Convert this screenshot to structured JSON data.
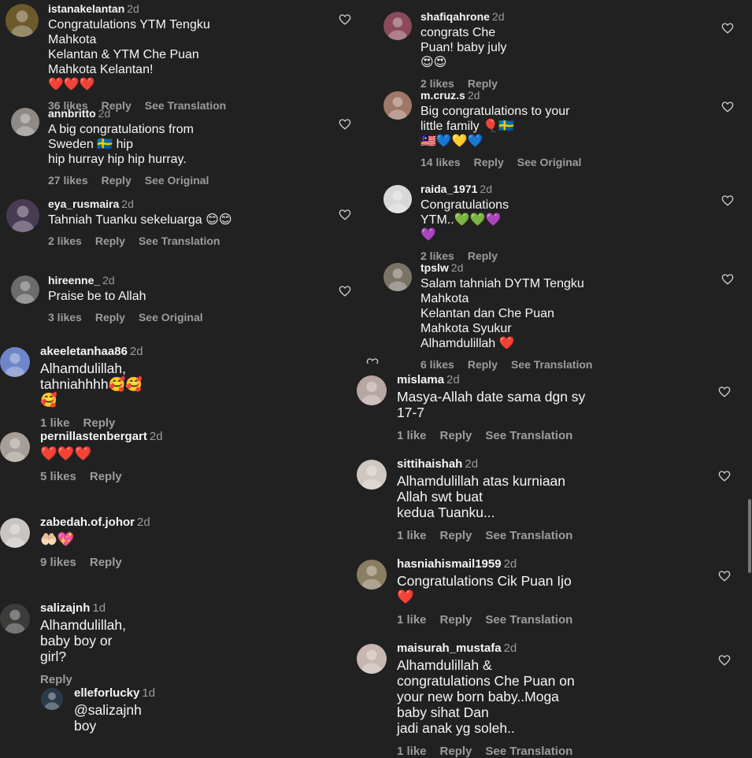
{
  "comments": [
    {
      "user": "istanakelantan",
      "time": "2d",
      "text": "Congratulations YTM Tengku Mahkota\nKelantan & YTM Che Puan Mahkota Kelantan!\n❤️❤️❤️",
      "likes": "36 likes",
      "reply": "Reply",
      "extra": "See Translation",
      "avatar_color": "#6b5a2a"
    },
    {
      "user": "annbritto",
      "time": "2d",
      "text": "A big congratulations from Sweden 🇸🇪 hip\nhip hurray hip hip hurray.",
      "likes": "27 likes",
      "reply": "Reply",
      "extra": "See Original",
      "avatar_color": "#8f8a86"
    },
    {
      "user": "eya_rusmaira",
      "time": "2d",
      "text": "Tahniah Tuanku sekeluarga 😊😊",
      "likes": "2 likes",
      "reply": "Reply",
      "extra": "See Translation",
      "avatar_color": "#4a3b55"
    },
    {
      "user": "hireenne_",
      "time": "2d",
      "text": "Praise be to Allah",
      "likes": "3 likes",
      "reply": "Reply",
      "extra": "See Original",
      "avatar_color": "#6c6c6c"
    },
    {
      "user": "akeeletanhaa86",
      "time": "2d",
      "text": "Alhamdulillah, tahniahhhh🥰🥰🥰",
      "likes": "1 like",
      "reply": "Reply",
      "extra": "",
      "avatar_color": "#6f86c9"
    },
    {
      "user": "pernillastenbergart",
      "time": "2d",
      "text": "❤️❤️❤️",
      "likes": "5 likes",
      "reply": "Reply",
      "extra": "",
      "avatar_color": "#a79e97"
    },
    {
      "user": "zabedah.of.johor",
      "time": "2d",
      "text": "🤲🏻💖",
      "likes": "9 likes",
      "reply": "Reply",
      "extra": "",
      "avatar_color": "#c9c4c2"
    },
    {
      "user": "salizajnh",
      "time": "1d",
      "text": "Alhamdulillah, baby boy or girl?",
      "likes": "",
      "reply": "Reply",
      "extra": "",
      "avatar_color": "#3c3c3a"
    },
    {
      "user": "elleforlucky",
      "time": "1d",
      "text": "@salizajnh boy",
      "likes": "",
      "reply": "",
      "extra": "",
      "avatar_color": "#2b3a4a"
    },
    {
      "user": "shafiqahrone",
      "time": "2d",
      "text": "congrats Che Puan! baby july 😍😍",
      "likes": "2 likes",
      "reply": "Reply",
      "extra": "",
      "avatar_color": "#8a4a5a"
    },
    {
      "user": "m.cruz.s",
      "time": "2d",
      "text": "Big congratulations to your little family 🎈🇸🇪\n🇲🇾💙💛💙",
      "likes": "14 likes",
      "reply": "Reply",
      "extra": "See Original",
      "avatar_color": "#a07868"
    },
    {
      "user": "raida_1971",
      "time": "2d",
      "text": "Congratulations YTM..💚💚💜💜",
      "likes": "2 likes",
      "reply": "Reply",
      "extra": "",
      "avatar_color": "#d8d8d8"
    },
    {
      "user": "tpslw",
      "time": "2d",
      "text": "Salam tahniah DYTM Tengku Mahkota\nKelantan dan Che Puan Mahkota Syukur\nAlhamdulillah ❤️",
      "likes": "6 likes",
      "reply": "Reply",
      "extra": "See Translation",
      "avatar_color": "#7a7466"
    },
    {
      "user": "mislama",
      "time": "2d",
      "text": "Masya-Allah date sama dgn sy 17-7",
      "likes": "1 like",
      "reply": "Reply",
      "extra": "See Translation",
      "avatar_color": "#b7a7a2"
    },
    {
      "user": "sittihaishah",
      "time": "2d",
      "text": "Alhamdulillah atas kurniaan Allah swt buat\nkedua Tuanku...",
      "likes": "1 like",
      "reply": "Reply",
      "extra": "See Translation",
      "avatar_color": "#cfc7c0"
    },
    {
      "user": "hasniahismail1959",
      "time": "2d",
      "text": "Congratulations Cik Puan Ijo❤️",
      "likes": "1 like",
      "reply": "Reply",
      "extra": "See Translation",
      "avatar_color": "#8a7f62"
    },
    {
      "user": "maisurah_mustafa",
      "time": "2d",
      "text": "Alhamdulillah & congratulations Che Puan on\nyour new born baby..Moga baby sihat Dan\njadi anak yg soleh..",
      "likes": "1 like",
      "reply": "Reply",
      "extra": "See Translation",
      "avatar_color": "#c8b7b0"
    }
  ]
}
